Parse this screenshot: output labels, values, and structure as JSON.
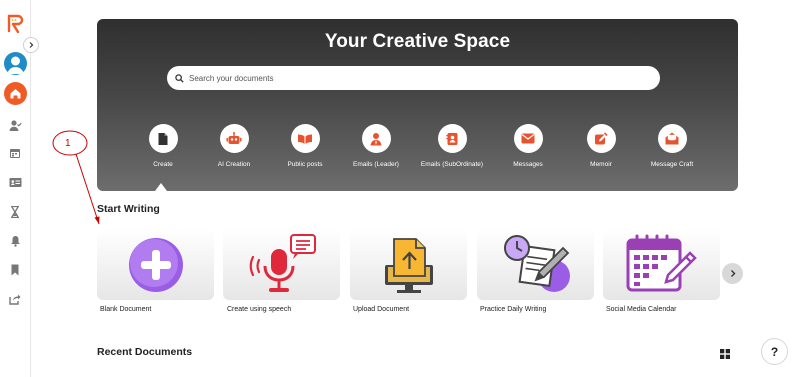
{
  "sidebar": {
    "icons": [
      "logo-icon",
      "avatar",
      "home-icon",
      "user-check-icon",
      "calendar-icon",
      "id-card-icon",
      "hourglass-icon",
      "bell-icon",
      "bookmark-icon",
      "share-icon"
    ],
    "collapse_icon": "chevron-right-icon"
  },
  "hero": {
    "title": "Your Creative Space",
    "search_placeholder": "Search your documents",
    "categories": [
      {
        "label": "Create",
        "icon": "document-icon"
      },
      {
        "label": "AI Creation",
        "icon": "robot-icon"
      },
      {
        "label": "Public posts",
        "icon": "book-open-icon"
      },
      {
        "label": "Emails (Leader)",
        "icon": "person-icon"
      },
      {
        "label": "Emails (SubOrdinate)",
        "icon": "contact-card-icon"
      },
      {
        "label": "Messages",
        "icon": "envelope-icon"
      },
      {
        "label": "Memoir",
        "icon": "pen-square-icon"
      },
      {
        "label": "Message Craft",
        "icon": "open-envelope-icon"
      }
    ]
  },
  "start_writing": {
    "title": "Start Writing",
    "cards": [
      {
        "label": "Blank Document",
        "icon": "plus-circle-icon"
      },
      {
        "label": "Create using speech",
        "icon": "microphone-icon"
      },
      {
        "label": "Upload Document",
        "icon": "upload-file-icon"
      },
      {
        "label": "Practice Daily Writing",
        "icon": "clock-notepad-icon"
      },
      {
        "label": "Social Media Calendar",
        "icon": "calendar-edit-icon"
      }
    ]
  },
  "recent": {
    "title": "Recent Documents",
    "view_icon": "grid-view-icon"
  },
  "help": {
    "label": "?"
  },
  "annotation": {
    "number": "1"
  },
  "colors": {
    "brand_orange": "#f15a24",
    "hero_icon_orange": "#e8532f",
    "purple": "#9b5de5",
    "red": "#e0283c"
  }
}
